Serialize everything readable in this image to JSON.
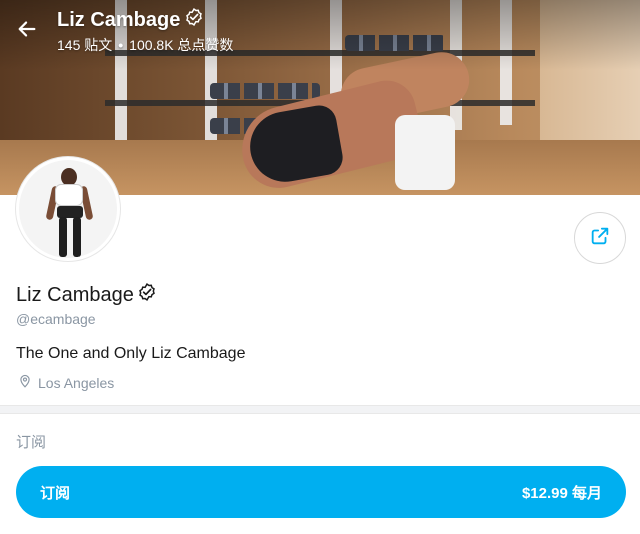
{
  "header": {
    "title": "Liz Cambage",
    "posts_count": "145 贴文",
    "separator": "•",
    "likes_count": "100.8K 总点赞数"
  },
  "profile": {
    "name": "Liz Cambage",
    "handle": "@ecambage",
    "bio": "The One and Only Liz Cambage",
    "location": "Los Angeles"
  },
  "subscription": {
    "heading": "订阅",
    "button_label": "订阅",
    "price": "$12.99 每月"
  },
  "icons": {
    "back": "arrow-left-icon",
    "verified": "verified-badge-icon",
    "share": "share-icon",
    "location": "location-pin-icon"
  },
  "colors": {
    "accent": "#00aff0",
    "muted_text": "#8a96a3",
    "divider": "#f2f3f5"
  }
}
